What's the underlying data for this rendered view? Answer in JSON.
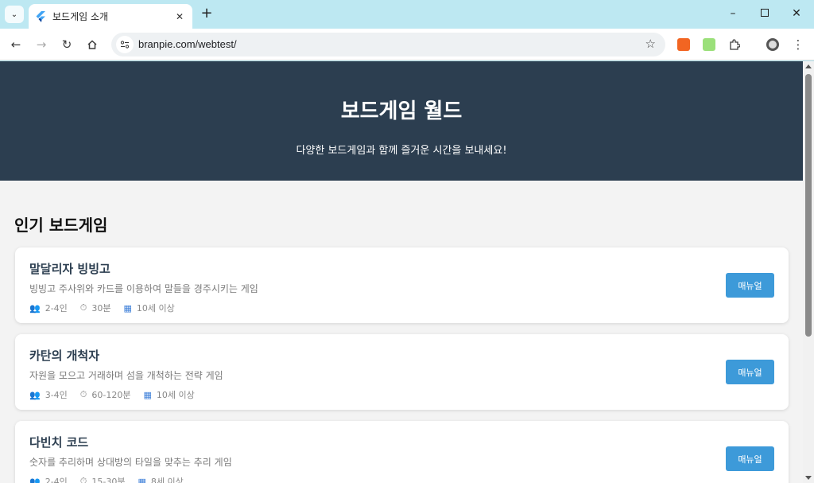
{
  "browser": {
    "tab_title": "보드게임 소개",
    "url": "branpie.com/webtest/"
  },
  "hero": {
    "title": "보드게임 월드",
    "subtitle": "다양한 보드게임과 함께 즐거운 시간을 보내세요!"
  },
  "section": {
    "title": "인기 보드게임"
  },
  "games": [
    {
      "name": "말달리자 빙빙고",
      "desc": "빙빙고 주사위와 카드를 이용하여 말들을 경주시키는 게임",
      "players": "2-4인",
      "time": "30분",
      "age": "10세 이상",
      "button": "매뉴얼"
    },
    {
      "name": "카탄의 개척자",
      "desc": "자원을 모으고 거래하며 섬을 개척하는 전략 게임",
      "players": "3-4인",
      "time": "60-120분",
      "age": "10세 이상",
      "button": "매뉴얼"
    },
    {
      "name": "다빈치 코드",
      "desc": "숫자를 추리하며 상대방의 타일을 맞추는 추리 게임",
      "players": "2-4인",
      "time": "15-30분",
      "age": "8세 이상",
      "button": "매뉴얼"
    }
  ],
  "icons": {
    "players": "people-icon",
    "time": "timer-icon",
    "age": "calendar-icon"
  },
  "colors": {
    "hero_bg": "#2c3e50",
    "button": "#3d9ad9",
    "page_bg": "#f3f3f3"
  }
}
